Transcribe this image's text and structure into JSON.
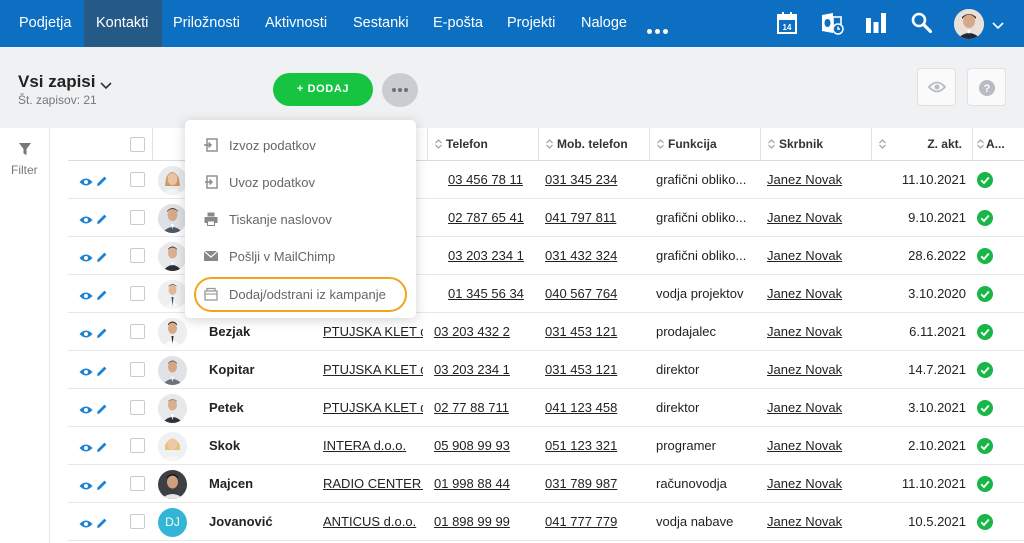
{
  "nav": {
    "items": [
      "Podjetja",
      "Kontakti",
      "Priložnosti",
      "Aktivnosti",
      "Sestanki",
      "E-pošta",
      "Projekti",
      "Naloge"
    ],
    "active": "Kontakti",
    "calendar_day": "14",
    "icons": [
      "calendar-icon",
      "outlook-icon",
      "reports-icon",
      "search-icon",
      "user-avatar",
      "chevron-down-icon"
    ]
  },
  "header": {
    "title": "Vsi zapisi",
    "record_count": "Št. zapisov: 21",
    "add_label": "+ DODAJ"
  },
  "filter": {
    "label": "Filter"
  },
  "table": {
    "columns": [
      "",
      "",
      "Telefon",
      "Mob. telefon",
      "Funkcija",
      "Skrbnik",
      "Z. akt.",
      "A..."
    ],
    "rows": [
      {
        "surname": "",
        "company": "",
        "phone": "03 456 78 11",
        "mobile": "031 345 234",
        "role": "grafični obliko...",
        "owner": "Janez Novak",
        "last": "11.10.2021"
      },
      {
        "surname": "",
        "company": "",
        "phone": "02 787 65 41",
        "mobile": "041 797 811",
        "role": "grafični obliko...",
        "owner": "Janez Novak",
        "last": "9.10.2021"
      },
      {
        "surname": "",
        "company": "",
        "phone": "03 203 234 1",
        "mobile": "031 432 324",
        "role": "grafični obliko...",
        "owner": "Janez Novak",
        "last": "28.6.2022"
      },
      {
        "surname": "",
        "company": "",
        "phone": "01 345 56 34",
        "mobile": "040 567 764",
        "role": "vodja projektov",
        "owner": "Janez Novak",
        "last": "3.10.2020"
      },
      {
        "surname": "Bezjak",
        "company": "PTUJSKA KLET d.d.",
        "phone": "03 203 432 2",
        "mobile": "031 453 121",
        "role": "prodajalec",
        "owner": "Janez Novak",
        "last": "6.11.2021"
      },
      {
        "surname": "Kopitar",
        "company": "PTUJSKA KLET d.d.",
        "phone": "03 203 234 1",
        "mobile": "031 453 121",
        "role": "direktor",
        "owner": "Janez Novak",
        "last": "14.7.2021"
      },
      {
        "surname": "Petek",
        "company": "PTUJSKA KLET d.d.",
        "phone": "02 77 88 711",
        "mobile": "041 123 458",
        "role": "direktor",
        "owner": "Janez Novak",
        "last": "3.10.2021"
      },
      {
        "surname": "Skok",
        "company": "INTERA d.o.o.",
        "phone": "05 908 99 93",
        "mobile": "051 123 321",
        "role": "programer",
        "owner": "Janez Novak",
        "last": "2.10.2021"
      },
      {
        "surname": "Majcen",
        "company": "RADIO CENTER d.o.o.",
        "phone": "01 998 88 44",
        "mobile": "031 789 987",
        "role": "računovodja",
        "owner": "Janez Novak",
        "last": "11.10.2021"
      },
      {
        "surname": "Jovanović",
        "company": "ANTICUS d.o.o.",
        "phone": "01 898 99 99",
        "mobile": "041 777 779",
        "role": "vodja nabave",
        "owner": "Janez Novak",
        "last": "10.5.2021",
        "initials": "DJ"
      }
    ]
  },
  "menu": {
    "items": [
      "Izvoz podatkov",
      "Uvoz podatkov",
      "Tiskanje naslovov",
      "Pošlji v MailChimp",
      "Dodaj/odstrani iz kampanje"
    ],
    "highlighted_index": 4
  },
  "colors": {
    "nav_bg": "#0d6fc1",
    "active_tab": "#255a87",
    "add_green": "#16c441",
    "highlight": "#f2a51d",
    "status_green": "#17b646",
    "initials_bg": "#33b6d6"
  }
}
